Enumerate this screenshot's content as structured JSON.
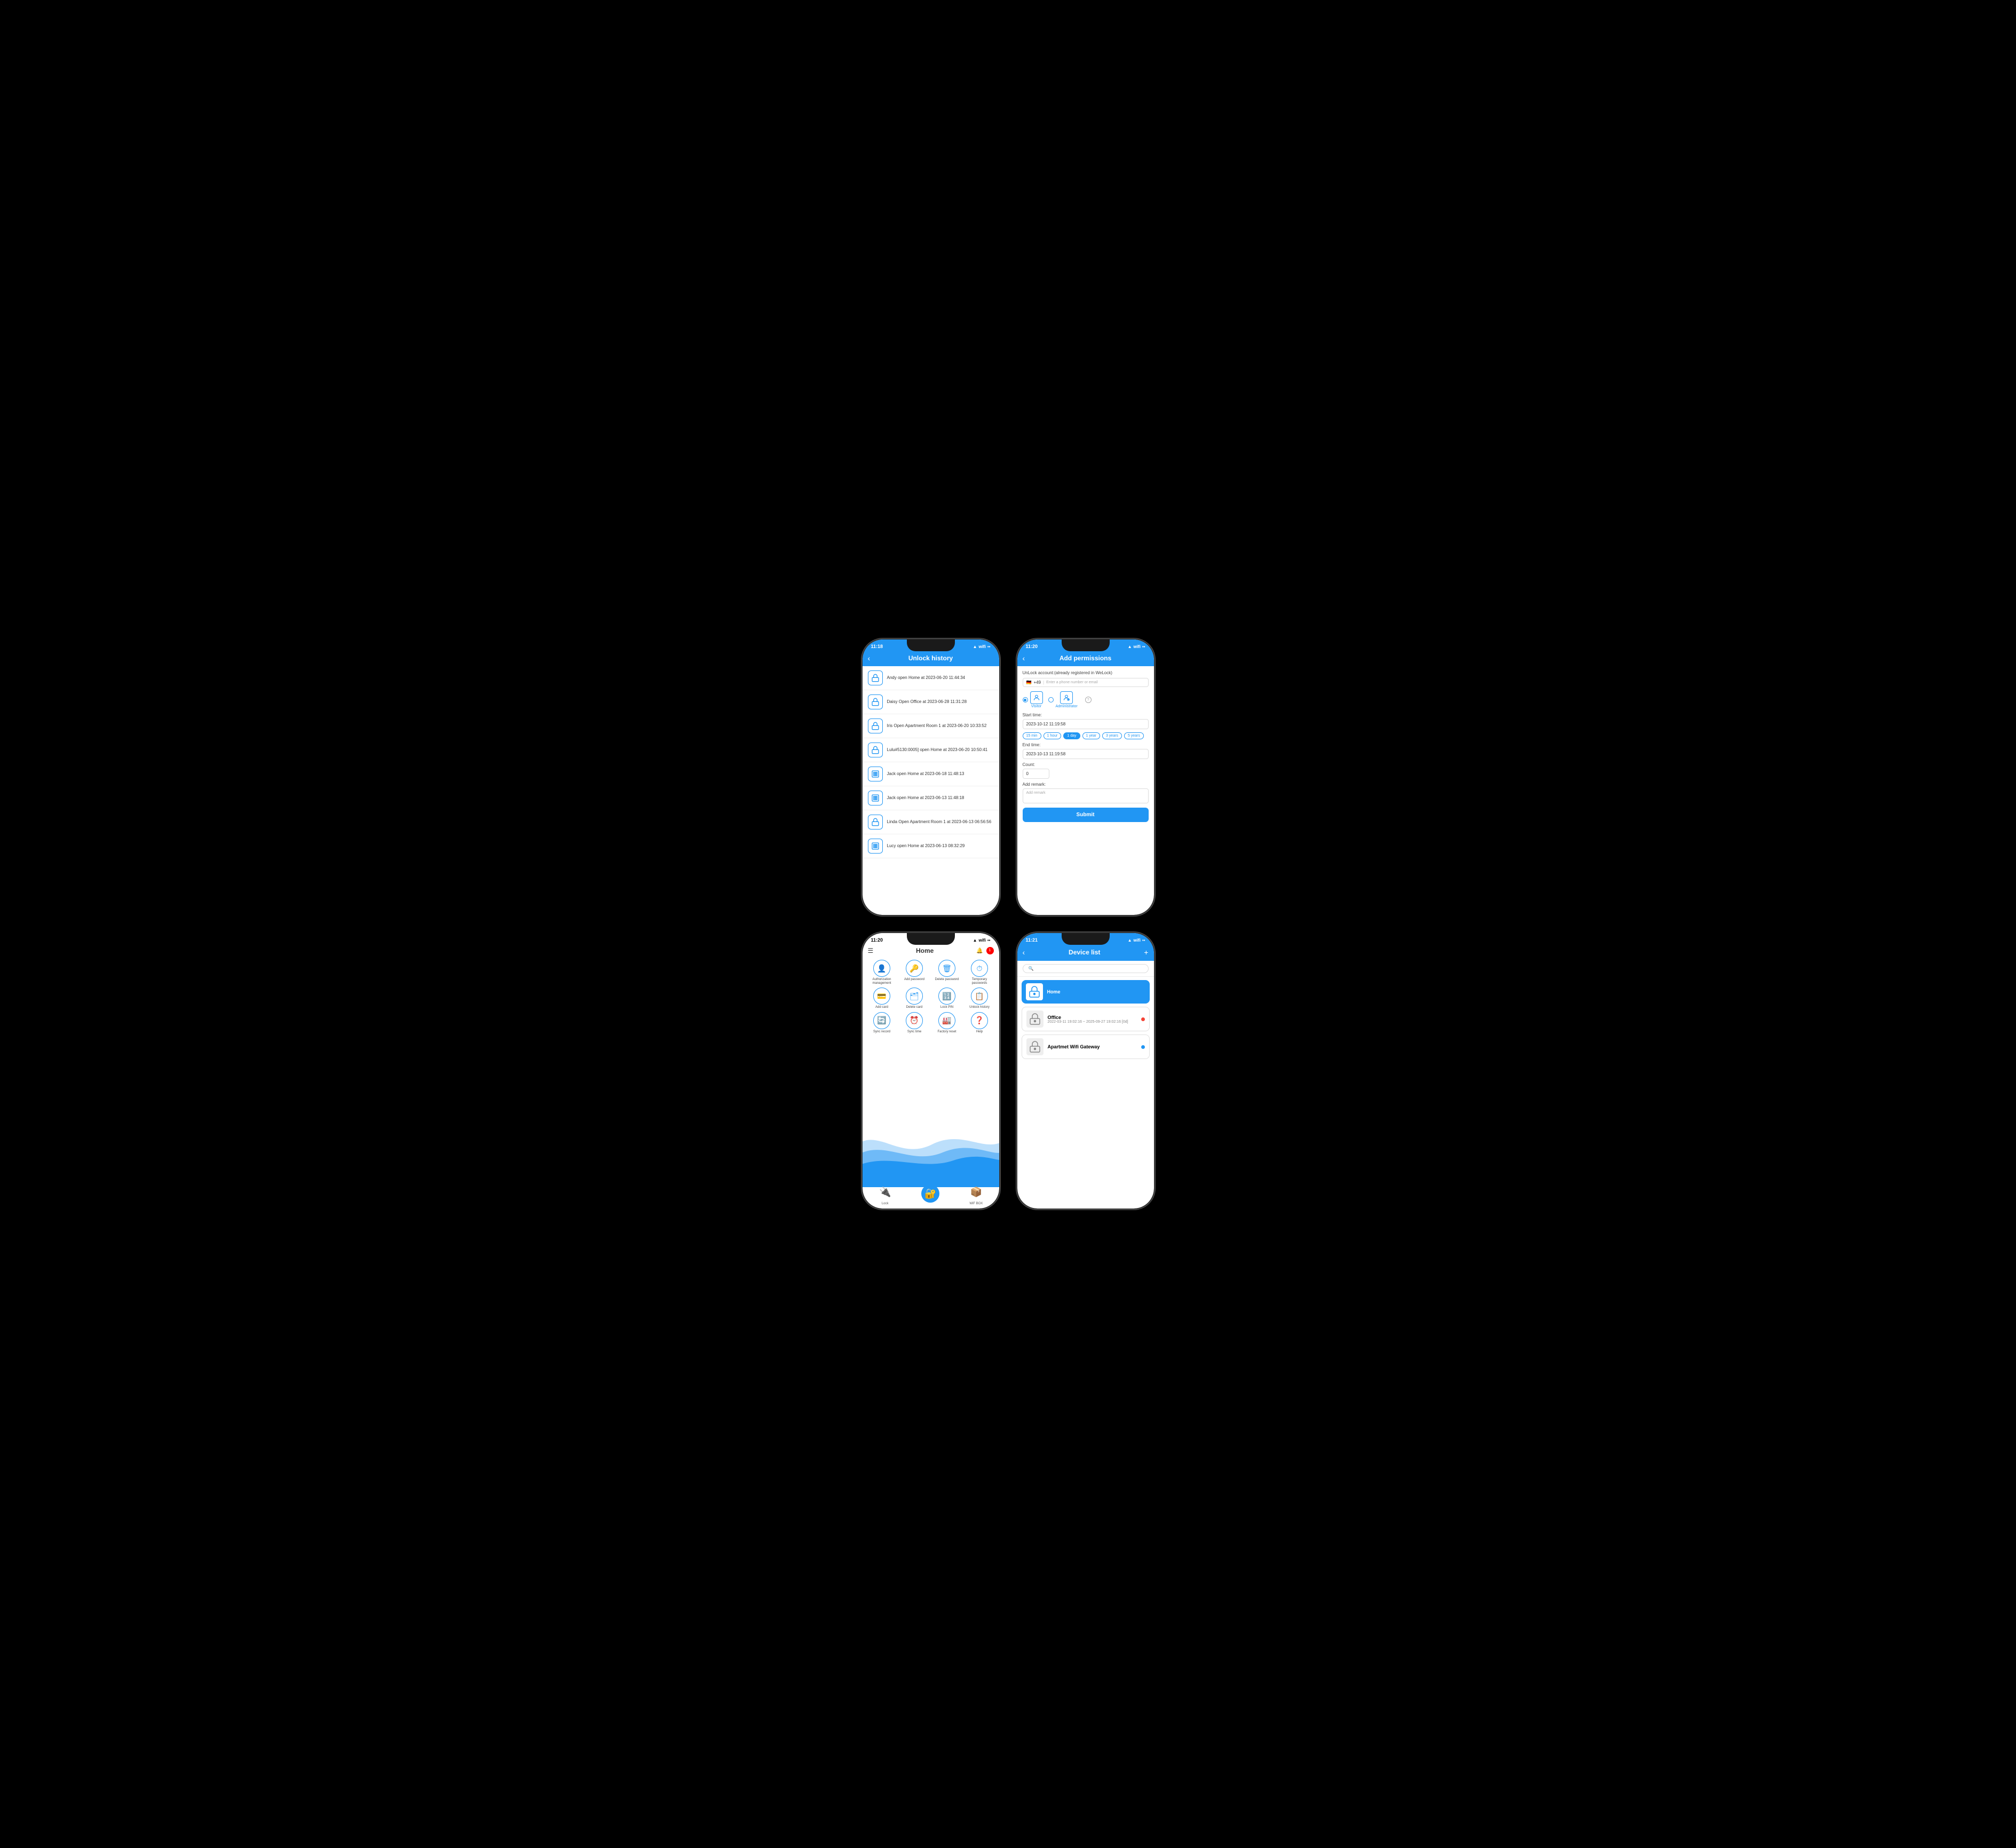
{
  "phones": {
    "phone1": {
      "statusBar": {
        "time": "11:18",
        "icons": "signal wifi battery"
      },
      "header": {
        "title": "Unlock history",
        "backLabel": "‹"
      },
      "historyItems": [
        {
          "id": 1,
          "icon": "lock",
          "text": "Andy open Home at 2023-06-20 11:44:34"
        },
        {
          "id": 2,
          "icon": "lock",
          "text": "Daisy Open Office at 2023-06-28 11:31:28"
        },
        {
          "id": 3,
          "icon": "lock",
          "text": "Iris Open Apartment Room 1 at 2023-06-20 10:33:52"
        },
        {
          "id": 4,
          "icon": "lock",
          "text": "Lulu#5130:0005] open Home at 2023-06-20 10:50:41"
        },
        {
          "id": 5,
          "icon": "numpad",
          "text": "Jack open Home at 2023-06-18 11:48:13"
        },
        {
          "id": 6,
          "icon": "numpad",
          "text": "Jack open Home at 2023-06-13 11:48:18"
        },
        {
          "id": 7,
          "icon": "lock",
          "text": "Linda Open Apartment Room 1 at 2023-06-13 06:56:56"
        },
        {
          "id": 8,
          "icon": "numpad",
          "text": "Lucy open Home at 2023-06-13 08:32:29"
        }
      ]
    },
    "phone2": {
      "statusBar": {
        "time": "11:20",
        "icons": "signal wifi battery"
      },
      "header": {
        "title": "Add permissions",
        "backLabel": "‹"
      },
      "accountLabel": "UnLock account:(already registered in WeLock)",
      "countryCode": "+49",
      "inputPlaceholder": "Enter a phone number or email",
      "visitorLabel": "Visitor",
      "administratorLabel": "Administrator",
      "startTimeLabel": "Start time:",
      "startTimeValue": "2023-10-12 11:19:58",
      "timePills": [
        "15 min",
        "1 hour",
        "1 day",
        "1 year",
        "3 years",
        "5 years"
      ],
      "activePill": "1 day",
      "endTimeLabel": "End time:",
      "endTimeValue": "2023-10-13 11:19:58",
      "countLabel": "Count:",
      "countValue": "0",
      "remarkLabel": "Add remark:",
      "remarkPlaceholder": "Add remark",
      "submitLabel": "Submit"
    },
    "phone3": {
      "statusBar": {
        "time": "11:20",
        "icons": "signal wifi battery"
      },
      "header": {
        "title": "Home",
        "menuIcon": "☰",
        "bellIcon": "🔔"
      },
      "actions": [
        {
          "label": "Authorization management",
          "icon": "👤"
        },
        {
          "label": "Add password",
          "icon": "🔑"
        },
        {
          "label": "Delete password",
          "icon": "🗑"
        },
        {
          "label": "Temporary passwords",
          "icon": "⏱"
        },
        {
          "label": "Add card",
          "icon": "💳"
        },
        {
          "label": "Delete card",
          "icon": "🗂"
        },
        {
          "label": "Lock PIN",
          "icon": "🔢"
        },
        {
          "label": "Unlock history",
          "icon": "📋"
        },
        {
          "label": "Sync record",
          "icon": "🔄"
        },
        {
          "label": "Sync time",
          "icon": "⏰"
        },
        {
          "label": "Factory reset",
          "icon": "🏭"
        },
        {
          "label": "Help",
          "icon": "❓"
        }
      ],
      "tabs": [
        {
          "label": "Lock",
          "icon": "🔌",
          "active": false
        },
        {
          "label": "",
          "icon": "🔐",
          "active": true
        },
        {
          "label": "WiF BOX",
          "icon": "📦",
          "active": false
        }
      ]
    },
    "phone4": {
      "statusBar": {
        "time": "11:21",
        "icons": "signal wifi battery"
      },
      "header": {
        "title": "Device list",
        "backLabel": "‹",
        "addLabel": "+"
      },
      "searchPlaceholder": "🔍",
      "devices": [
        {
          "id": 1,
          "name": "Home",
          "meta": "",
          "status": "active",
          "icon": "🔒"
        },
        {
          "id": 2,
          "name": "Office",
          "meta": "2022-03-11 19:02:16 ~ 2025-09-27 19:02:16 [0d]",
          "status": "offline",
          "icon": "🔒"
        },
        {
          "id": 3,
          "name": "Apartmet Wifi Gateway",
          "meta": "",
          "status": "online",
          "icon": "📡"
        }
      ]
    }
  }
}
